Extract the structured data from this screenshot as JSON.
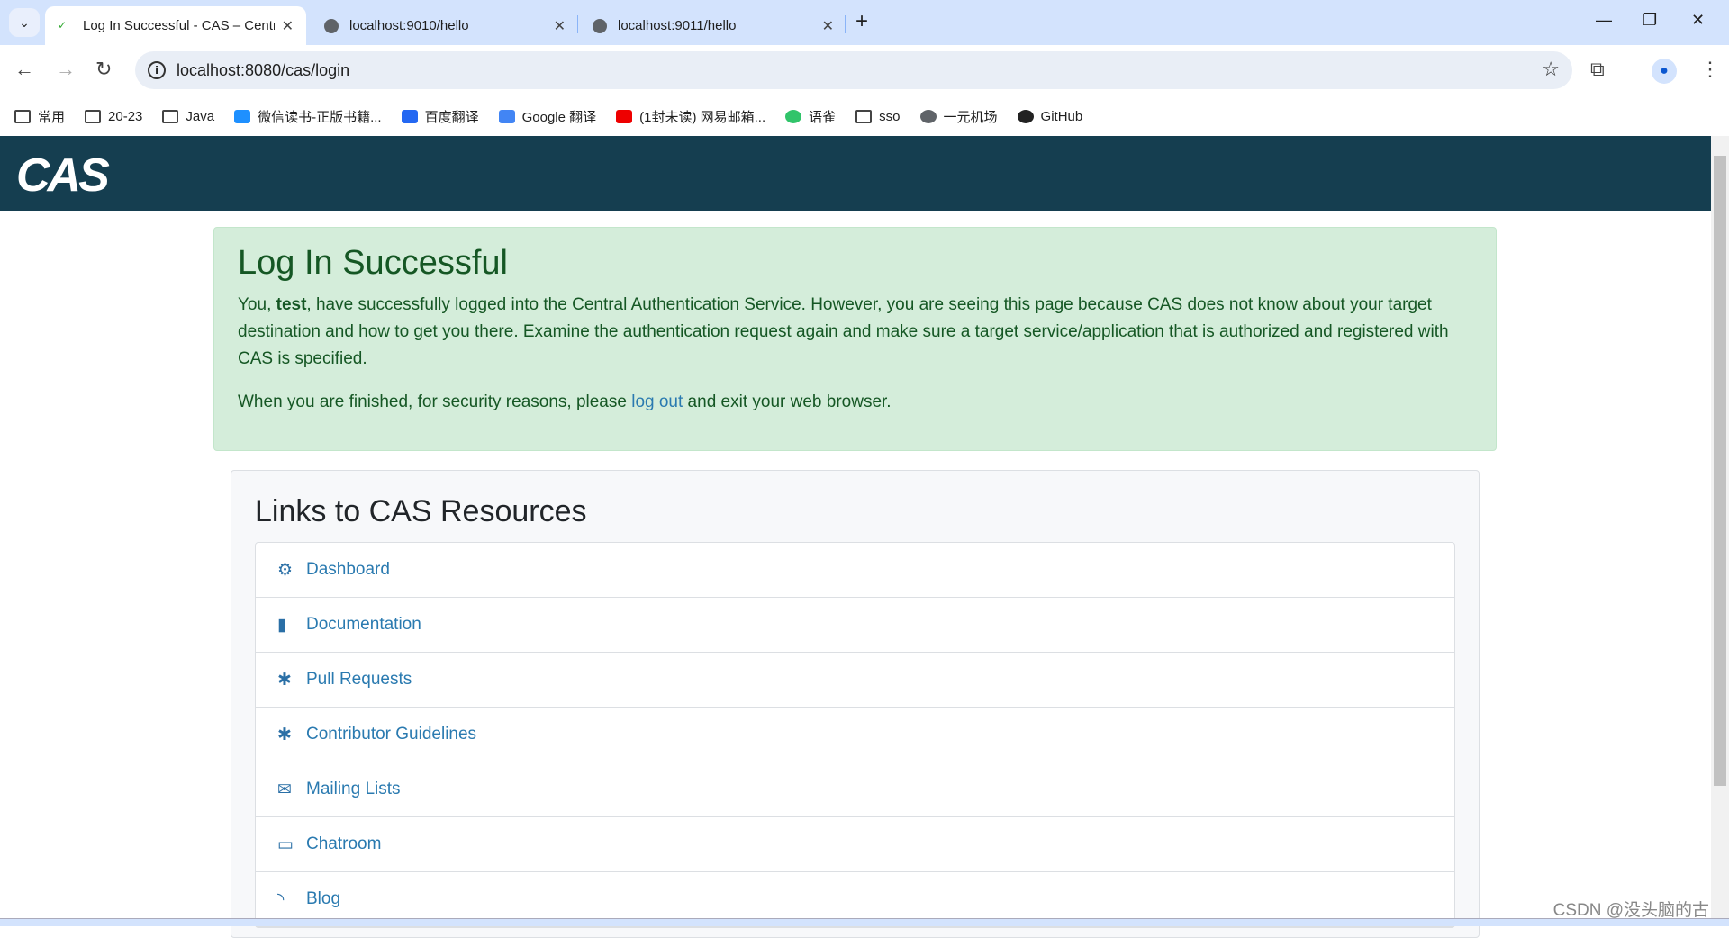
{
  "browser": {
    "tabs": [
      {
        "title": "Log In Successful - CAS – Central Authentication Service",
        "active": true
      },
      {
        "title": "localhost:9010/hello",
        "active": false
      },
      {
        "title": "localhost:9011/hello",
        "active": false
      }
    ],
    "url": "localhost:8080/cas/login",
    "bookmarks": [
      "常用",
      "20-23",
      "Java",
      "微信读书-正版书籍...",
      "百度翻译",
      "Google 翻译",
      "(1封未读) 网易邮箱...",
      "语雀",
      "sso",
      "一元机场",
      "GitHub"
    ]
  },
  "header": {
    "logo": "CAS",
    "brand_color": "#153e50"
  },
  "success": {
    "title": "Log In Successful",
    "p1_before": "You, ",
    "user": "test",
    "p1_after": ", have successfully logged into the Central Authentication Service. However, you are seeing this page because CAS does not know about your target destination and how to get you there. Examine the authentication request again and make sure a target service/application that is authorized and registered with CAS is specified.",
    "p2_before": "When you are finished, for security reasons, please ",
    "logout": "log out",
    "p2_after": " and exit your web browser."
  },
  "resources": {
    "title": "Links to CAS Resources",
    "items": [
      {
        "label": "Dashboard",
        "icon": "cogs-icon"
      },
      {
        "label": "Documentation",
        "icon": "file-icon"
      },
      {
        "label": "Pull Requests",
        "icon": "bug-icon"
      },
      {
        "label": "Contributor Guidelines",
        "icon": "bug-icon"
      },
      {
        "label": "Mailing Lists",
        "icon": "envelope-icon"
      },
      {
        "label": "Chatroom",
        "icon": "comment-icon"
      },
      {
        "label": "Blog",
        "icon": "rss-icon"
      }
    ]
  },
  "watermark": "CSDN @没头脑的古"
}
